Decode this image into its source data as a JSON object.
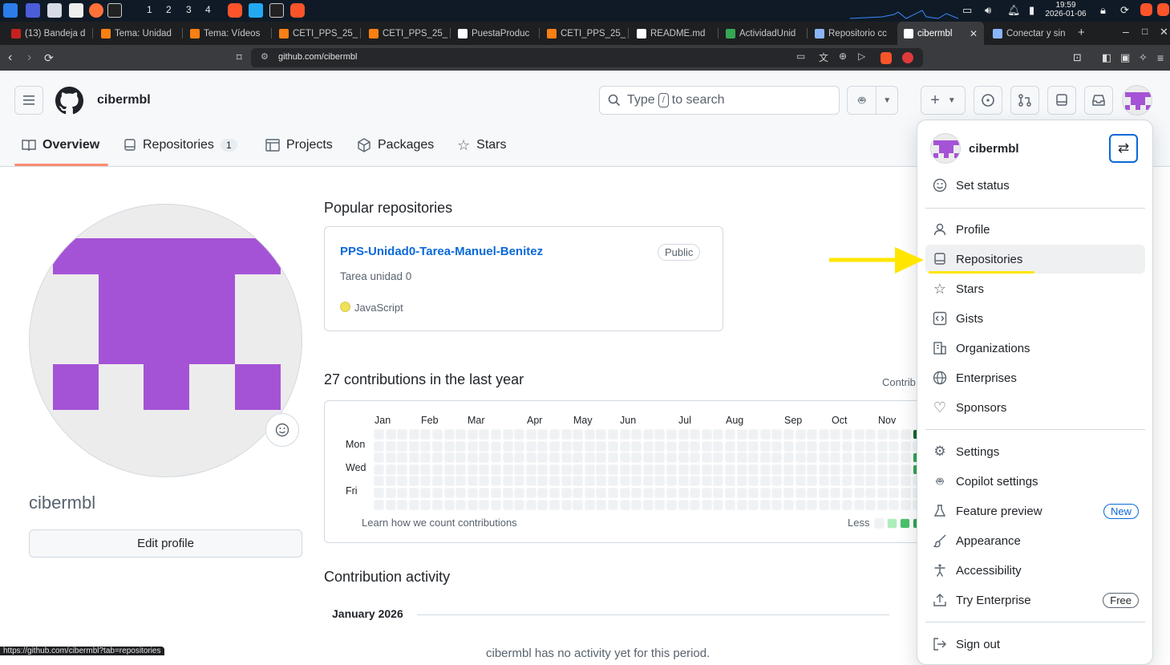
{
  "taskbar": {
    "workspaces": [
      "1",
      "2",
      "3",
      "4"
    ],
    "clock_time": "19:59",
    "clock_date": "2026-01-06"
  },
  "browser": {
    "tabs": [
      {
        "label": "(13) Bandeja d",
        "icon": "gmail-icon",
        "color": "#c5221f"
      },
      {
        "label": "Tema: Unidad",
        "icon": "moodle-icon",
        "color": "#f98012"
      },
      {
        "label": "Tema: Vídeos",
        "icon": "moodle-icon",
        "color": "#f98012"
      },
      {
        "label": "CETI_PPS_25_",
        "icon": "moodle-icon",
        "color": "#f98012"
      },
      {
        "label": "CETI_PPS_25_",
        "icon": "moodle-icon",
        "color": "#f98012"
      },
      {
        "label": "PuestaProduc",
        "icon": "github-icon",
        "color": "#ffffff"
      },
      {
        "label": "CETI_PPS_25_",
        "icon": "moodle-icon",
        "color": "#f98012"
      },
      {
        "label": "README.md",
        "icon": "github-icon",
        "color": "#ffffff"
      },
      {
        "label": "ActividadUnid",
        "icon": "drive-icon",
        "color": "#34a853"
      },
      {
        "label": "Repositorio cc",
        "icon": "wordpress-icon",
        "color": "#8ab4f8"
      },
      {
        "label": "cibermbl",
        "icon": "github-icon",
        "color": "#ffffff",
        "active": true
      },
      {
        "label": "Conectar y sin",
        "icon": "wordpress-icon",
        "color": "#8ab4f8"
      }
    ],
    "url": "github.com/cibermbl",
    "status_url": "https://github.com/cibermbl?tab=repositories"
  },
  "header": {
    "username": "cibermbl",
    "search_prefix": "Type",
    "search_key": "/",
    "search_suffix": "to search"
  },
  "nav": {
    "overview": "Overview",
    "repositories": "Repositories",
    "repositories_count": "1",
    "projects": "Projects",
    "packages": "Packages",
    "stars": "Stars"
  },
  "profile": {
    "name": "cibermbl",
    "edit_label": "Edit profile",
    "avatar_color": "#a553d6"
  },
  "popular": {
    "title": "Popular repositories",
    "repo": {
      "name": "PPS-Unidad0-Tarea-Manuel-Benitez",
      "visibility": "Public",
      "description": "Tarea unidad 0",
      "language": "JavaScript",
      "language_color": "#f1e05a"
    }
  },
  "contributions": {
    "title": "27 contributions in the last year",
    "settings_partial": "Contrib",
    "months": [
      "Jan",
      "Feb",
      "Mar",
      "Apr",
      "May",
      "Jun",
      "Jul",
      "Aug",
      "Sep",
      "Oct",
      "Nov"
    ],
    "days": [
      "Mon",
      "Wed",
      "Fri"
    ],
    "learn_link": "Learn how we count contributions",
    "less_label": "Less"
  },
  "activity": {
    "title": "Contribution activity",
    "month": "January 2026",
    "empty": "cibermbl has no activity yet for this period."
  },
  "menu": {
    "username": "cibermbl",
    "items": {
      "set_status": "Set status",
      "profile": "Profile",
      "repositories": "Repositories",
      "stars": "Stars",
      "gists": "Gists",
      "organizations": "Organizations",
      "enterprises": "Enterprises",
      "sponsors": "Sponsors",
      "settings": "Settings",
      "copilot_settings": "Copilot settings",
      "feature_preview": "Feature preview",
      "feature_preview_badge": "New",
      "appearance": "Appearance",
      "accessibility": "Accessibility",
      "try_enterprise": "Try Enterprise",
      "try_enterprise_badge": "Free",
      "sign_out": "Sign out"
    }
  },
  "annotation": {
    "arrow_color": "#ffe600"
  }
}
